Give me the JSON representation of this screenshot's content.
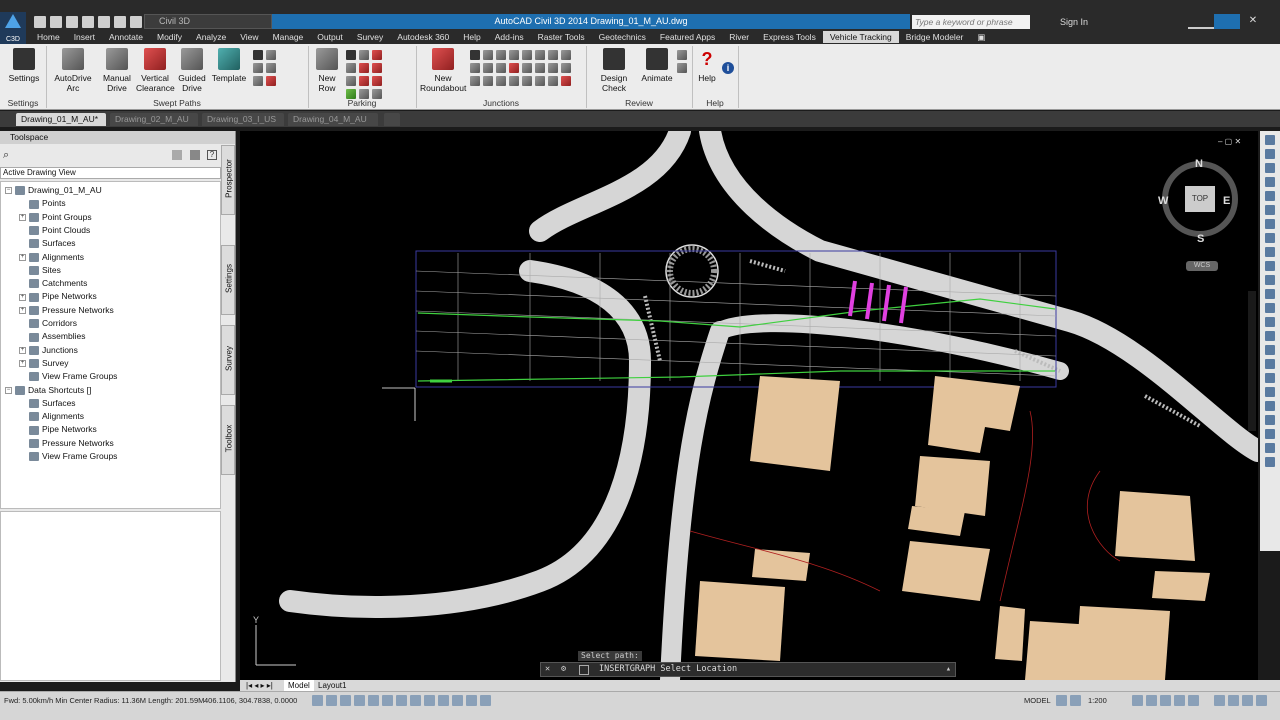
{
  "window": {
    "workspace": "Civil 3D",
    "title": "AutoCAD Civil 3D 2014    Drawing_01_M_AU.dwg",
    "search_placeholder": "Type a keyword or phrase",
    "signin": "Sign In",
    "app_badge": "C3D"
  },
  "ribbon_tabs": [
    "Home",
    "Insert",
    "Annotate",
    "Modify",
    "Analyze",
    "View",
    "Manage",
    "Output",
    "Survey",
    "Autodesk 360",
    "Help",
    "Add-ins",
    "Raster Tools",
    "Geotechnics",
    "Featured Apps",
    "River",
    "Express Tools",
    "Vehicle Tracking",
    "Bridge Modeler"
  ],
  "active_tab": "Vehicle Tracking",
  "ribbon": {
    "settings": "Settings",
    "autodrive_arc_1": "AutoDrive",
    "autodrive_arc_2": "Arc",
    "manual_drive_1": "Manual",
    "manual_drive_2": "Drive",
    "vertical_clearance_1": "Vertical",
    "vertical_clearance_2": "Clearance",
    "guided_drive_1": "Guided",
    "guided_drive_2": "Drive",
    "template": "Template",
    "new_row_1": "New",
    "new_row_2": "Row",
    "new_roundabout_1": "New",
    "new_roundabout_2": "Roundabout",
    "design_check": "Design Check",
    "animate": "Animate",
    "help": "Help",
    "groups": {
      "settings": "Settings",
      "swept_paths": "Swept Paths",
      "parking": "Parking",
      "junctions": "Junctions",
      "review": "Review",
      "help": "Help"
    }
  },
  "doc_tabs": [
    "Drawing_01_M_AU*",
    "Drawing_02_M_AU",
    "Drawing_03_I_US",
    "Drawing_04_M_AU"
  ],
  "toolspace": {
    "title": "Toolspace",
    "view": "Active Drawing View",
    "tree": [
      "Drawing_01_M_AU",
      "Points",
      "Point Groups",
      "Point Clouds",
      "Surfaces",
      "Alignments",
      "Sites",
      "Catchments",
      "Pipe Networks",
      "Pressure Networks",
      "Corridors",
      "Assemblies",
      "Junctions",
      "Survey",
      "View Frame Groups",
      "Data Shortcuts []",
      "Surfaces",
      "Alignments",
      "Pipe Networks",
      "Pressure Networks",
      "View Frame Groups"
    ],
    "side_tabs": [
      "Prospector",
      "Settings",
      "Survey",
      "Toolbox"
    ]
  },
  "viewcube": {
    "n": "N",
    "s": "S",
    "e": "E",
    "w": "W",
    "face": "TOP",
    "wcs": "WCS"
  },
  "command": {
    "history": "Select path:",
    "prompt": "INSERTGRAPH Select Location"
  },
  "layout_tabs": [
    "Model",
    "Layout1"
  ],
  "status": {
    "info": "Fwd: 5.00km/h Min Center Radius: 11.36M Length: 201.59M",
    "coords": "406.1106, 304.7838, 0.0000",
    "model": "MODEL",
    "scale": "1:200"
  }
}
